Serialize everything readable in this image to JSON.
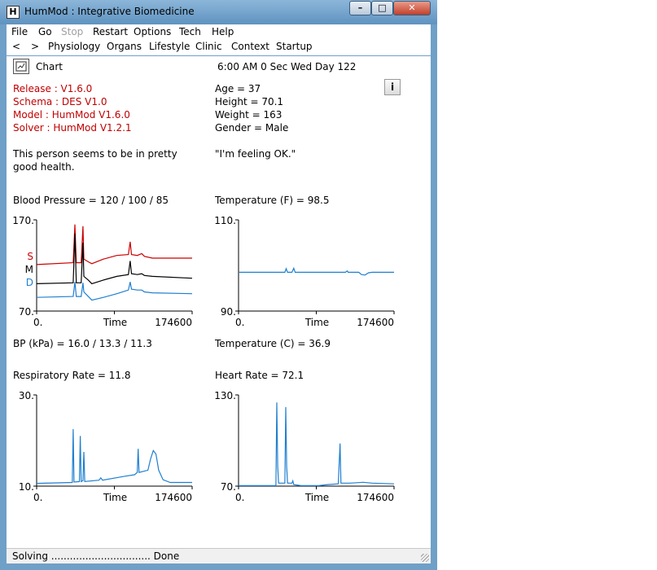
{
  "window": {
    "title": "HumMod : Integrative Biomedicine",
    "app_icon": "H"
  },
  "menubar": [
    {
      "label": "File",
      "enabled": true
    },
    {
      "label": "Go",
      "enabled": true
    },
    {
      "label": "Stop",
      "enabled": false
    },
    {
      "label": "Restart",
      "enabled": true
    },
    {
      "label": "Options",
      "enabled": true
    },
    {
      "label": "Tech",
      "enabled": true
    },
    {
      "label": "Help",
      "enabled": true
    }
  ],
  "navbar": [
    "<",
    ">",
    "Physiology",
    "Organs",
    "Lifestyle",
    "Clinic",
    "Context",
    "Startup"
  ],
  "header": {
    "chart_label": "Chart",
    "clock": "6:00 AM  0 Sec Wed Day 122",
    "info_button": "i"
  },
  "versions": [
    "Release : V1.6.0",
    "Schema : DES V1.0",
    "Model : HumMod V1.6.0",
    "Solver : HumMod V1.2.1"
  ],
  "patient": [
    "Age =  37",
    "Height =  70.1",
    "Weight =  163",
    "Gender =  Male"
  ],
  "status_message": [
    "This person seems to be in pretty",
    "good health."
  ],
  "quote": "\"I'm feeling OK.\"",
  "labels": {
    "bp": "Blood Pressure =  120   / 100 / 85",
    "bp_kpa": "BP (kPa) =  16.0   / 13.3  / 11.3",
    "temp_f": "Temperature (F) =  98.5",
    "temp_c": "Temperature (C) =  36.9",
    "resp": "Respiratory Rate =  11.8",
    "hr": "Heart Rate =  72.1"
  },
  "colors": {
    "red": "#cc0000",
    "black": "#000000",
    "blue": "#1f7fd0",
    "text_red": "#c00000"
  },
  "chart_data": [
    {
      "type": "line",
      "id": "bp",
      "xlabel": "Time",
      "xticks": [
        "0.",
        "174600"
      ],
      "yticks": [
        "170.",
        "70."
      ],
      "ylim": [
        70,
        170
      ],
      "xlim": [
        0,
        174600
      ],
      "legend": [
        "S",
        "M",
        "D"
      ],
      "series": [
        {
          "name": "S",
          "color": "#cc0000",
          "values": [
            [
              0,
              121
            ],
            [
              41000,
              123
            ],
            [
              43000,
              165
            ],
            [
              44500,
              123
            ],
            [
              50000,
              123
            ],
            [
              52000,
              163
            ],
            [
              53000,
              127
            ],
            [
              58000,
              124
            ],
            [
              62000,
              122
            ],
            [
              75000,
              127
            ],
            [
              90000,
              131
            ],
            [
              103000,
              132
            ],
            [
              105000,
              146
            ],
            [
              106500,
              132
            ],
            [
              113000,
              131
            ],
            [
              118000,
              133
            ],
            [
              121000,
              130
            ],
            [
              130000,
              128
            ],
            [
              174600,
              128
            ]
          ]
        },
        {
          "name": "M",
          "color": "#000000",
          "values": [
            [
              0,
              100
            ],
            [
              41000,
              101
            ],
            [
              43000,
              155
            ],
            [
              44500,
              101
            ],
            [
              50000,
              101
            ],
            [
              52000,
              145
            ],
            [
              53000,
              108
            ],
            [
              58000,
              104
            ],
            [
              62000,
              100
            ],
            [
              75000,
              104
            ],
            [
              90000,
              108
            ],
            [
              103000,
              110
            ],
            [
              105000,
              125
            ],
            [
              106500,
              111
            ],
            [
              113000,
              110
            ],
            [
              118000,
              111
            ],
            [
              121000,
              109
            ],
            [
              130000,
              108
            ],
            [
              174600,
              106
            ]
          ]
        },
        {
          "name": "D",
          "color": "#1f7fd0",
          "values": [
            [
              0,
              85
            ],
            [
              41000,
              86
            ],
            [
              43000,
              102
            ],
            [
              44500,
              86
            ],
            [
              50000,
              86
            ],
            [
              52000,
              101
            ],
            [
              53000,
              91
            ],
            [
              58000,
              86
            ],
            [
              62000,
              82
            ],
            [
              75000,
              85
            ],
            [
              90000,
              89
            ],
            [
              103000,
              93
            ],
            [
              105000,
              102
            ],
            [
              106500,
              94
            ],
            [
              113000,
              93
            ],
            [
              118000,
              93
            ],
            [
              121000,
              91
            ],
            [
              130000,
              90
            ],
            [
              174600,
              89
            ]
          ]
        }
      ]
    },
    {
      "type": "line",
      "id": "temp_f",
      "xlabel": "Time",
      "xticks": [
        "0.",
        "174600"
      ],
      "yticks": [
        "110.",
        "90."
      ],
      "ylim": [
        90,
        110
      ],
      "xlim": [
        0,
        174600
      ],
      "series": [
        {
          "name": "",
          "color": "#1f7fd0",
          "values": [
            [
              0,
              98.5
            ],
            [
              52000,
              98.5
            ],
            [
              53500,
              99.3
            ],
            [
              55000,
              98.5
            ],
            [
              60000,
              98.5
            ],
            [
              62000,
              99.4
            ],
            [
              63500,
              98.5
            ],
            [
              120000,
              98.5
            ],
            [
              122000,
              98.8
            ],
            [
              123000,
              98.5
            ],
            [
              135000,
              98.5
            ],
            [
              138000,
              98.0
            ],
            [
              142000,
              97.9
            ],
            [
              146000,
              98.4
            ],
            [
              150000,
              98.5
            ],
            [
              174600,
              98.5
            ]
          ]
        }
      ]
    },
    {
      "type": "line",
      "id": "resp",
      "xlabel": "Time",
      "xticks": [
        "0.",
        "174600"
      ],
      "yticks": [
        "30.",
        "10."
      ],
      "ylim": [
        10,
        30
      ],
      "xlim": [
        0,
        174600
      ],
      "series": [
        {
          "name": "",
          "color": "#1f7fd0",
          "values": [
            [
              0,
              10.6
            ],
            [
              40000,
              10.8
            ],
            [
              41000,
              22.5
            ],
            [
              42000,
              10.9
            ],
            [
              48000,
              11.0
            ],
            [
              49000,
              21.0
            ],
            [
              50000,
              11.0
            ],
            [
              52000,
              11.2
            ],
            [
              53000,
              17.5
            ],
            [
              54000,
              11.0
            ],
            [
              70000,
              11.3
            ],
            [
              72000,
              11.8
            ],
            [
              74000,
              11.3
            ],
            [
              100000,
              12.2
            ],
            [
              110000,
              12.5
            ],
            [
              113000,
              13.0
            ],
            [
              114000,
              18.2
            ],
            [
              115000,
              13.0
            ],
            [
              125000,
              13.5
            ],
            [
              128000,
              16.0
            ],
            [
              131000,
              17.8
            ],
            [
              134000,
              17.0
            ],
            [
              137000,
              13.5
            ],
            [
              142000,
              11.4
            ],
            [
              150000,
              10.8
            ],
            [
              174600,
              10.8
            ]
          ]
        }
      ]
    },
    {
      "type": "line",
      "id": "hr",
      "xlabel": "Time",
      "xticks": [
        "0.",
        "174600"
      ],
      "yticks": [
        "130.",
        "70."
      ],
      "ylim": [
        70,
        130
      ],
      "xlim": [
        0,
        174600
      ],
      "series": [
        {
          "name": "",
          "color": "#1f7fd0",
          "values": [
            [
              0,
              70.3
            ],
            [
              42000,
              70.3
            ],
            [
              43000,
              125
            ],
            [
              44000,
              83
            ],
            [
              45000,
              72
            ],
            [
              52000,
              72
            ],
            [
              53000,
              122
            ],
            [
              54000,
              83
            ],
            [
              55000,
              72
            ],
            [
              60000,
              72
            ],
            [
              61000,
              73.5
            ],
            [
              62000,
              71
            ],
            [
              70000,
              70.3
            ],
            [
              90000,
              70.3
            ],
            [
              100000,
              71
            ],
            [
              112000,
              71.5
            ],
            [
              114000,
              98
            ],
            [
              115000,
              72
            ],
            [
              125000,
              72
            ],
            [
              140000,
              72.5
            ],
            [
              150000,
              72
            ],
            [
              174600,
              71.5
            ]
          ]
        }
      ]
    }
  ],
  "status_bar": "Solving ................................ Done"
}
